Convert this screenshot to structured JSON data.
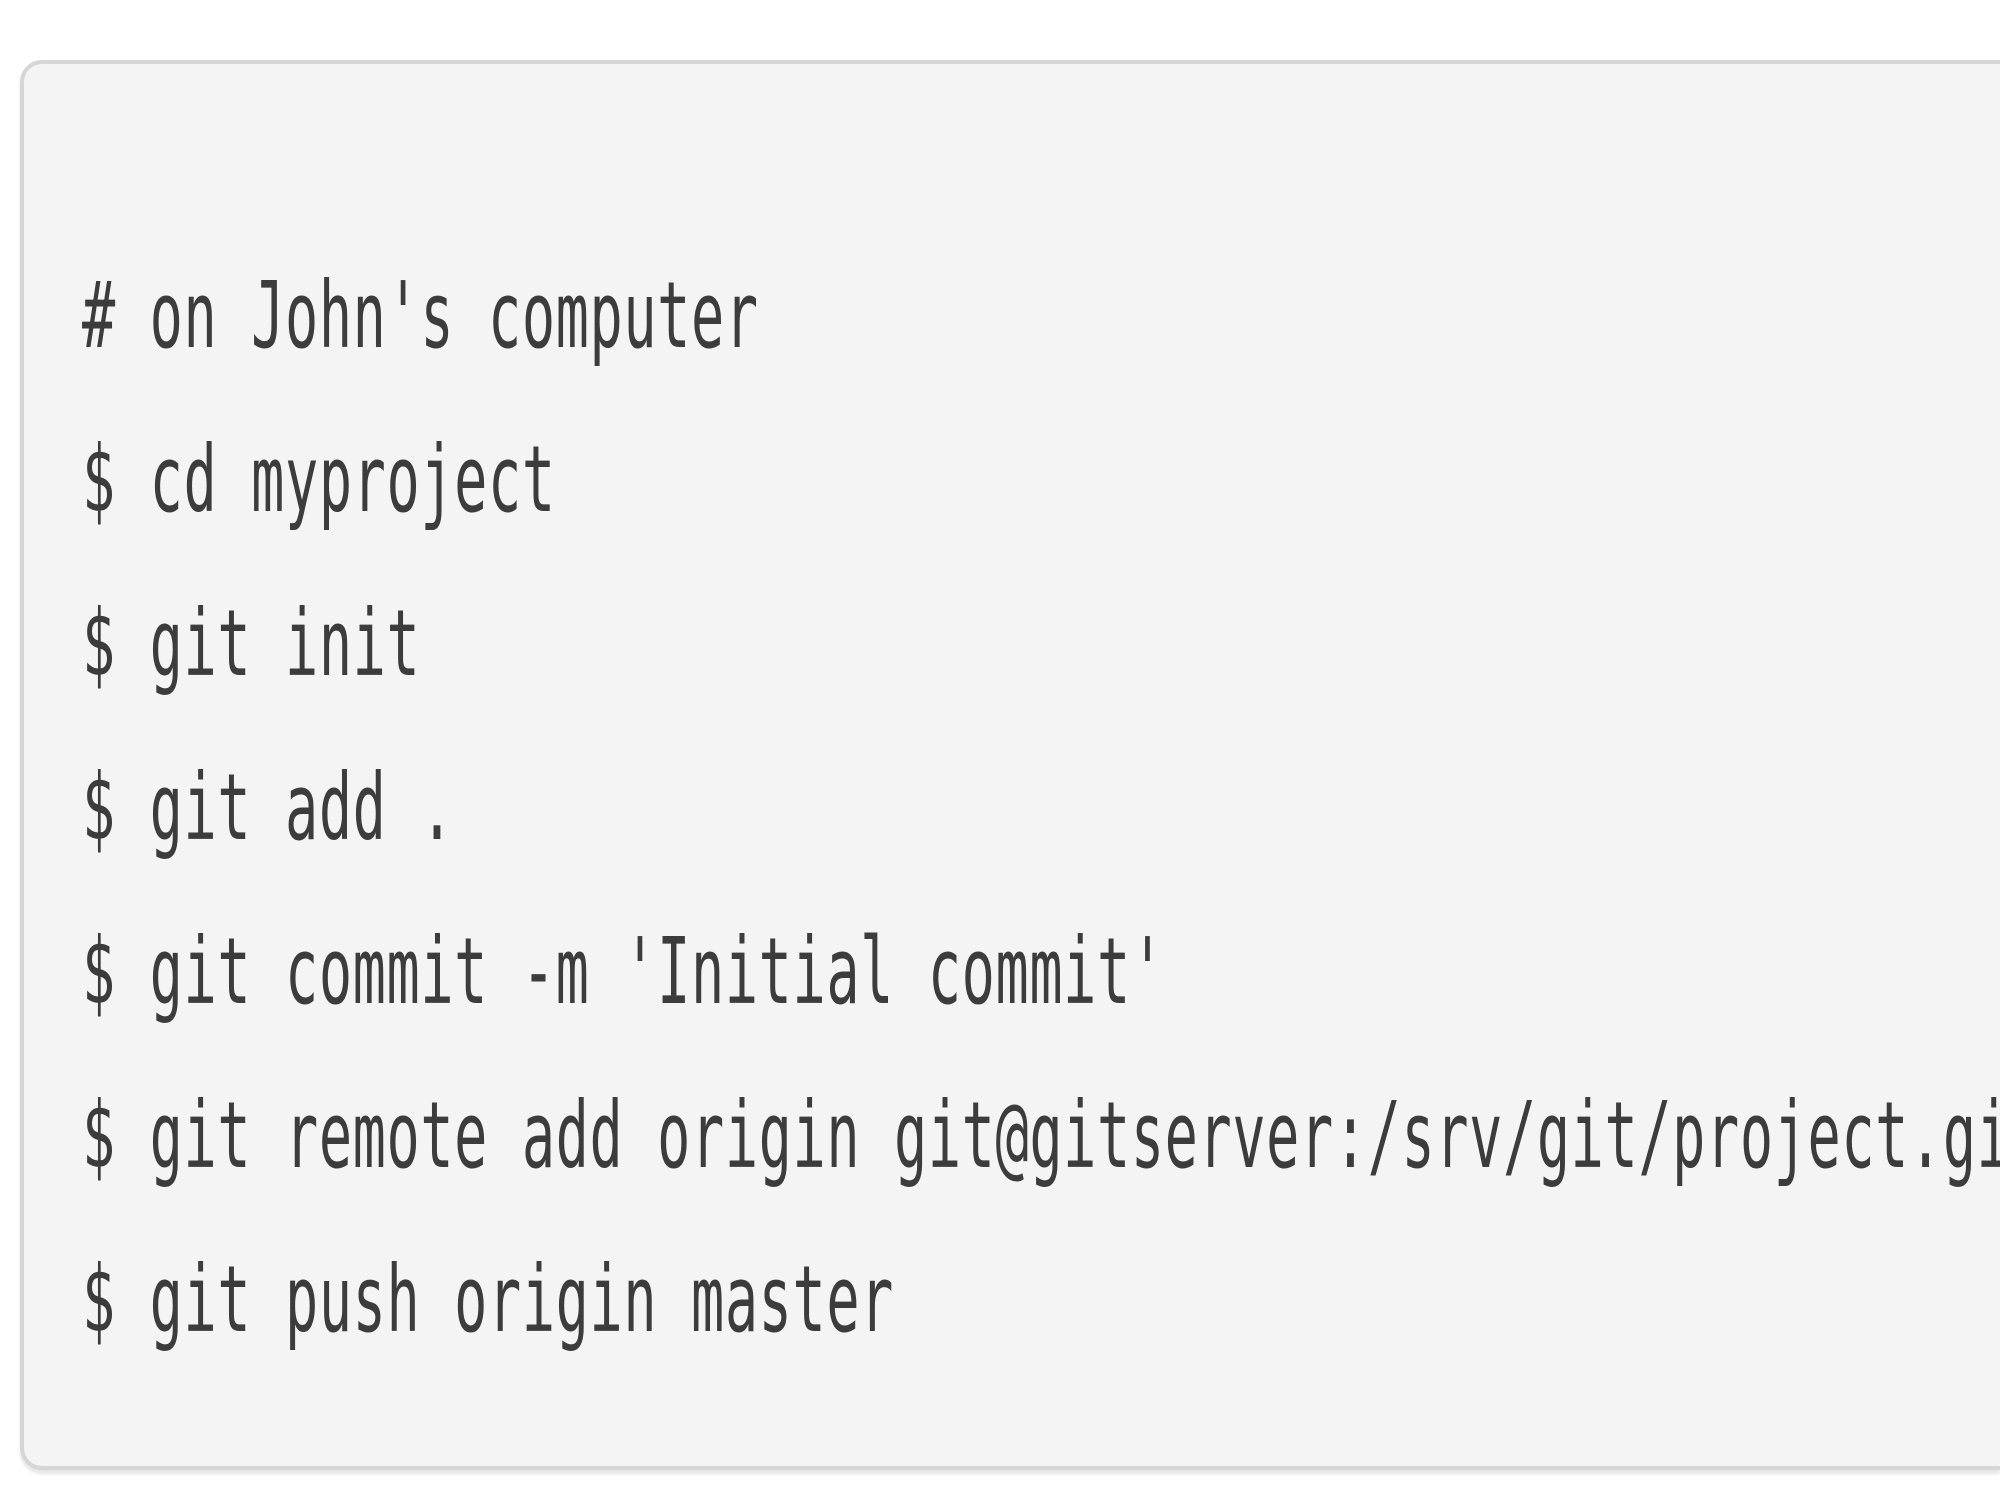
{
  "code_block": {
    "lines": [
      "# on John's computer",
      "$ cd myproject",
      "$ git init",
      "$ git add .",
      "$ git commit -m 'Initial commit'",
      "$ git remote add origin git@gitserver:/srv/git/project.git",
      "$ git push origin master"
    ]
  }
}
